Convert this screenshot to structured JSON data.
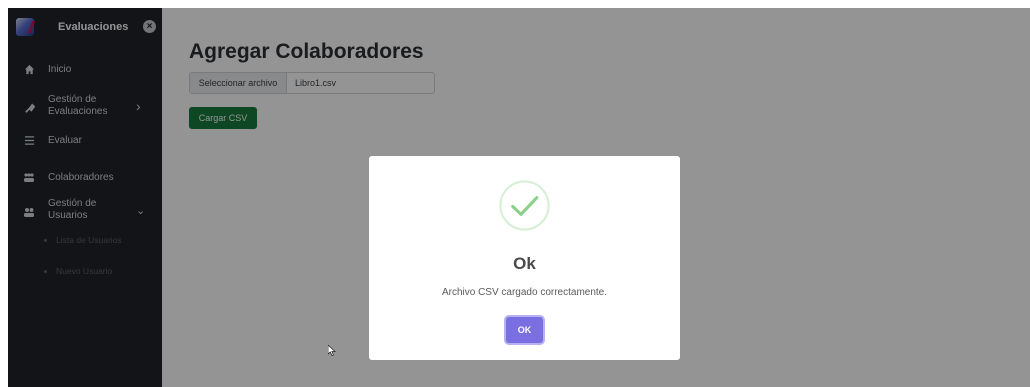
{
  "sidebar": {
    "brand_title": "Evaluaciones",
    "close_glyph": "×",
    "items": [
      {
        "label": "Inicio",
        "icon": "home-icon"
      },
      {
        "label": "Gestión de\nEvaluaciones",
        "icon": "wrench-icon",
        "chevron": "›"
      },
      {
        "label": "Evaluar",
        "icon": "list-check-icon"
      },
      {
        "label": "Colaboradores",
        "icon": "users-group-icon"
      },
      {
        "label": "Gestión de\nUsuarios",
        "icon": "users-icon",
        "chevron": "⌄"
      }
    ],
    "sub_items": [
      {
        "label": "Lista de Usuarios"
      },
      {
        "label": "Nuevo Usuario"
      }
    ]
  },
  "main": {
    "title": "Agregar Colaboradores",
    "file_button_label": "Seleccionar archivo",
    "file_name": "Libro1.csv",
    "upload_button_label": "Cargar CSV"
  },
  "modal": {
    "title": "Ok",
    "message": "Archivo CSV cargado correctamente.",
    "ok_label": "OK",
    "icon": "success-check-icon"
  },
  "colors": {
    "sidebar_bg": "#1f2429",
    "upload_button": "#177a3d",
    "success_check": "#8bd18b",
    "ok_button": "#7a6fe0"
  }
}
